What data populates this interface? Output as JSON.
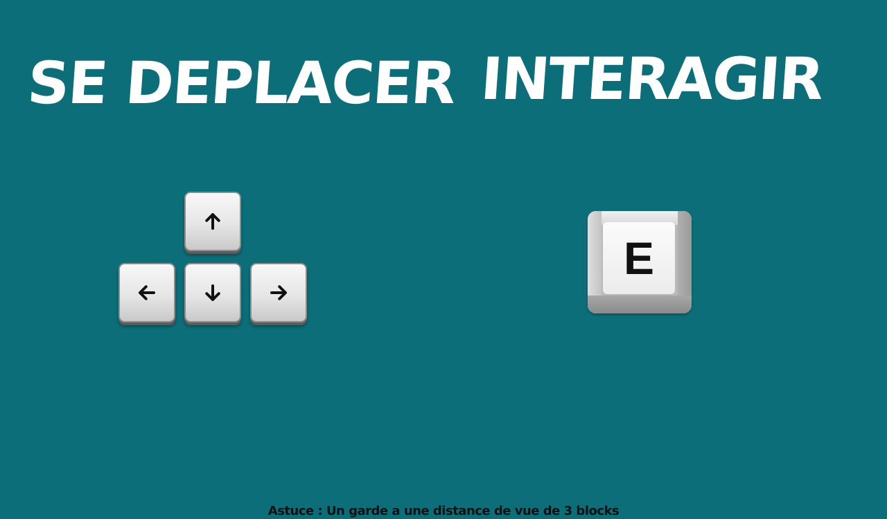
{
  "headings": {
    "move": "SE DEPLACER",
    "interact": "INTERAGIR"
  },
  "keys": {
    "up": "up-arrow-icon",
    "left": "left-arrow-icon",
    "down": "down-arrow-icon",
    "right": "right-arrow-icon",
    "interact_label": "E"
  },
  "colors": {
    "background": "#0c6e78",
    "heading": "#ffffff",
    "tip": "#111111"
  },
  "tip": "Astuce : Un garde a une distance de vue de 3 blocks"
}
